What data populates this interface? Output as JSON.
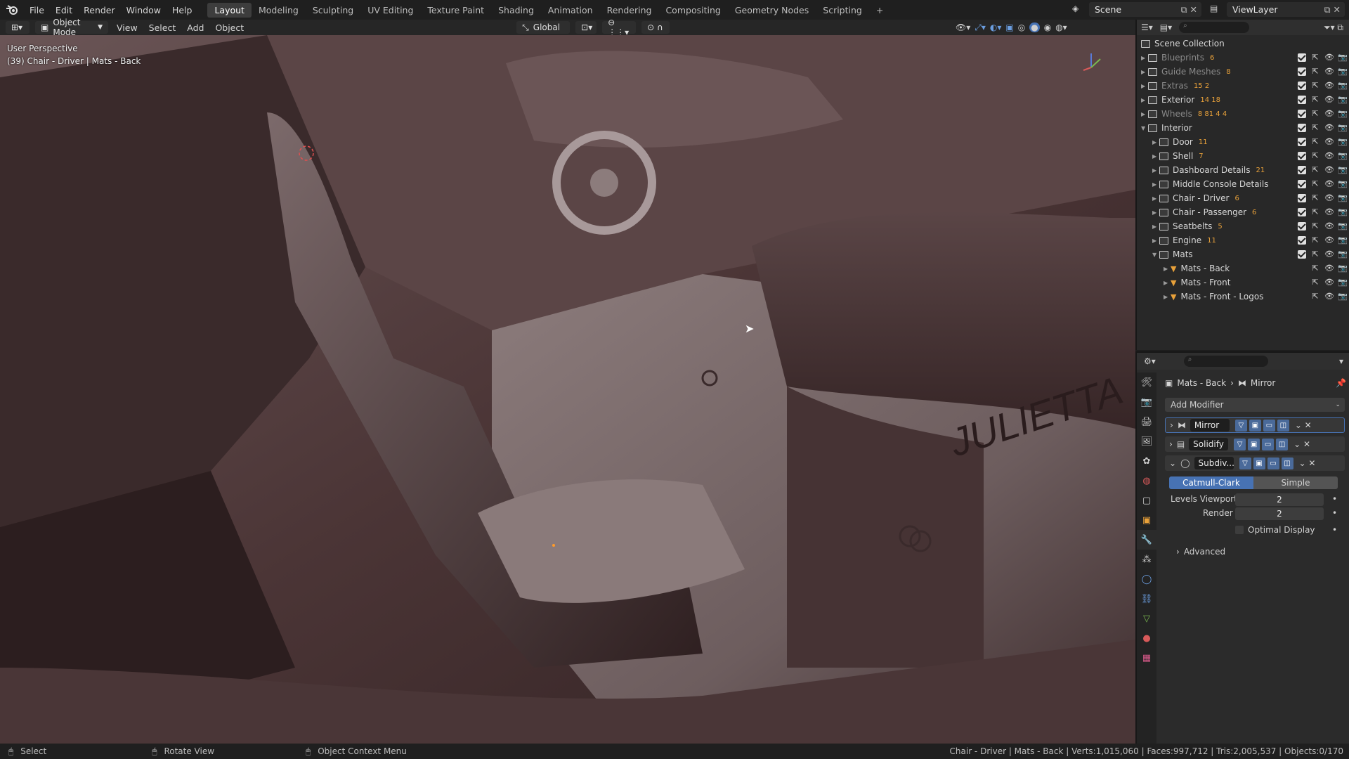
{
  "topbar": {
    "menus": [
      "File",
      "Edit",
      "Render",
      "Window",
      "Help"
    ],
    "workspaces": [
      "Layout",
      "Modeling",
      "Sculpting",
      "UV Editing",
      "Texture Paint",
      "Shading",
      "Animation",
      "Rendering",
      "Compositing",
      "Geometry Nodes",
      "Scripting"
    ],
    "active_workspace": "Layout",
    "scene": "Scene",
    "view_layer": "ViewLayer"
  },
  "viewport_header": {
    "mode": "Object Mode",
    "menus": [
      "View",
      "Select",
      "Add",
      "Object"
    ],
    "orientation": "Global"
  },
  "viewport": {
    "perspective": "User Perspective",
    "active_info": "(39) Chair - Driver | Mats - Back",
    "logo_text": "JULIETTA"
  },
  "outliner": {
    "root": "Scene Collection",
    "rows": [
      {
        "label": "Blueprints",
        "count": "6",
        "level": 0,
        "dim": true
      },
      {
        "label": "Guide Meshes",
        "count": "8",
        "level": 0,
        "dim": true
      },
      {
        "label": "Extras",
        "count": "15  2",
        "level": 0,
        "dim": true
      },
      {
        "label": "Exterior",
        "count": "14  18",
        "level": 0,
        "dim": false
      },
      {
        "label": "Wheels",
        "count": "8  81  4  4",
        "level": 0,
        "dim": true
      },
      {
        "label": "Interior",
        "count": "",
        "level": 0,
        "dim": false
      },
      {
        "label": "Door",
        "count": "11",
        "level": 1,
        "dim": false
      },
      {
        "label": "Shell",
        "count": "7",
        "level": 1,
        "dim": false
      },
      {
        "label": "Dashboard Details",
        "count": "21",
        "level": 1,
        "dim": false
      },
      {
        "label": "Middle Console Details",
        "count": "",
        "level": 1,
        "dim": false
      },
      {
        "label": "Chair - Driver",
        "count": "6",
        "level": 1,
        "dim": false
      },
      {
        "label": "Chair - Passenger",
        "count": "6",
        "level": 1,
        "dim": false
      },
      {
        "label": "Seatbelts",
        "count": "5",
        "level": 1,
        "dim": false
      },
      {
        "label": "Engine",
        "count": "11",
        "level": 1,
        "dim": false
      },
      {
        "label": "Mats",
        "count": "",
        "level": 1,
        "dim": false
      },
      {
        "label": "Mats - Back",
        "count": "",
        "level": 2,
        "dim": false
      },
      {
        "label": "Mats - Front",
        "count": "",
        "level": 2,
        "dim": false
      },
      {
        "label": "Mats - Front - Logos",
        "count": "",
        "level": 2,
        "dim": false
      }
    ]
  },
  "properties": {
    "breadcrumb_object": "Mats - Back",
    "breadcrumb_modifier": "Mirror",
    "add_modifier": "Add Modifier",
    "modifiers": [
      "Mirror",
      "Solidify",
      "Subdiv..."
    ],
    "subdiv_types": [
      "Catmull-Clark",
      "Simple"
    ],
    "levels_viewport_label": "Levels Viewport",
    "levels_viewport": "2",
    "render_label": "Render",
    "render": "2",
    "optimal_display": "Optimal Display",
    "advanced": "Advanced"
  },
  "statusbar": {
    "select": "Select",
    "rotate": "Rotate View",
    "context": "Object Context Menu",
    "stats": "Chair - Driver | Mats - Back | Verts:1,015,060 | Faces:997,712 | Tris:2,005,537 | Objects:0/170"
  },
  "colors": {
    "accent": "#4772b3",
    "car_interior": "#4a3536",
    "orange": "#e8a13a"
  }
}
